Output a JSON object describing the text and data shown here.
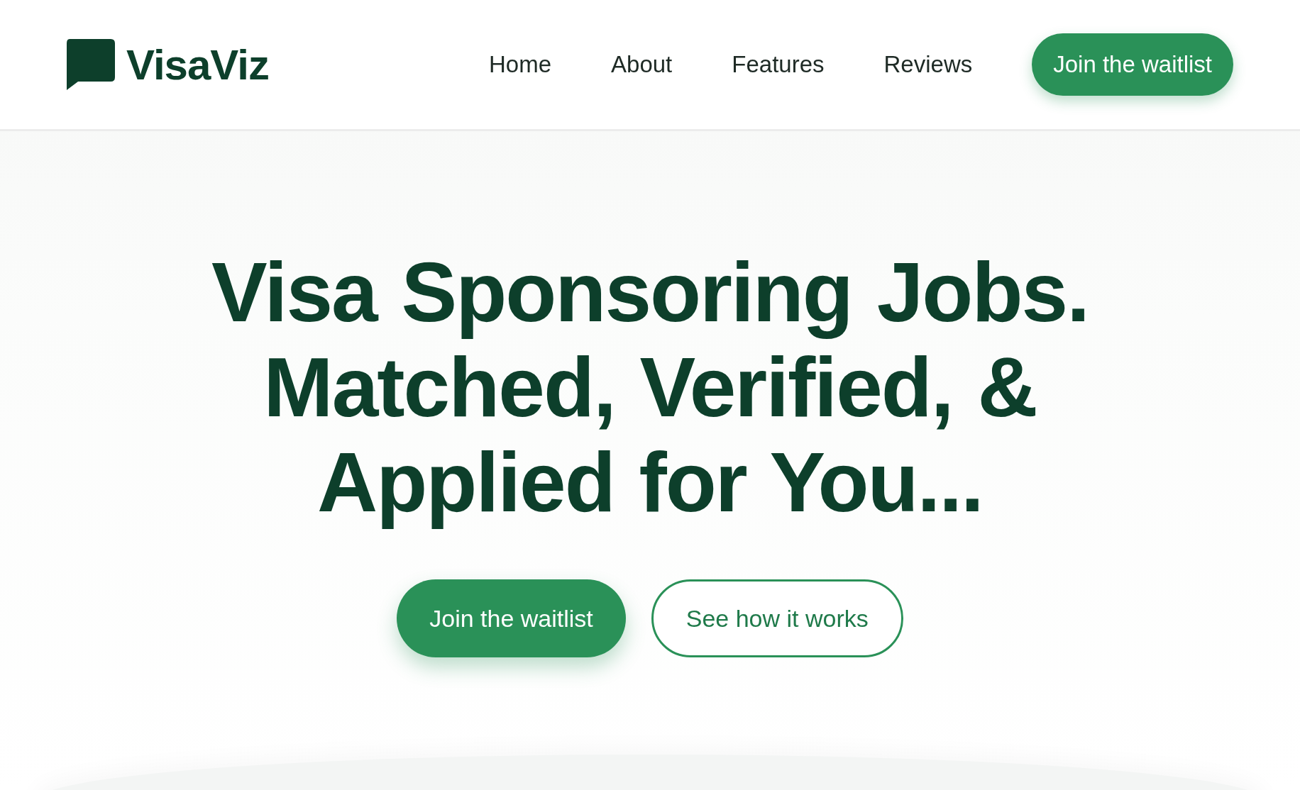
{
  "header": {
    "logo_text": "VisaViz",
    "nav": [
      {
        "label": "Home"
      },
      {
        "label": "About"
      },
      {
        "label": "Features"
      },
      {
        "label": "Reviews"
      }
    ],
    "cta": "Join the waitlist"
  },
  "hero": {
    "headline_lines": [
      "Visa Sponsoring Jobs.",
      "Matched, Verified, &",
      "Applied for You..."
    ],
    "buttons": [
      {
        "label": "Join the waitlist",
        "kind": "primary"
      },
      {
        "label": "See how it works",
        "kind": "outline"
      }
    ]
  }
}
